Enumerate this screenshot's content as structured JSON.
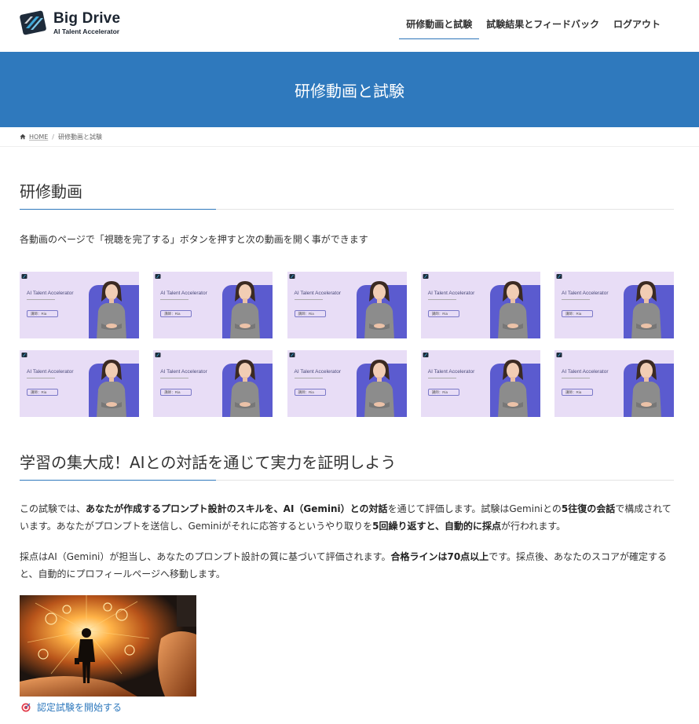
{
  "header": {
    "logo_title": "Big Drive",
    "logo_subtitle": "AI Talent Accelerator",
    "nav": [
      {
        "label": "研修動画と試験",
        "active": true
      },
      {
        "label": "試験結果とフィードバック",
        "active": false
      },
      {
        "label": "ログアウト",
        "active": false
      }
    ]
  },
  "page_title": "研修動画と試験",
  "breadcrumb": {
    "home": "HOME",
    "separator": "/",
    "current": "研修動画と試験"
  },
  "section_videos": {
    "title": "研修動画",
    "lead": "各動画のページで「視聴を完了する」ボタンを押すと次の動画を開く事ができます",
    "thumbnail_title": "AI Talent Accelerator",
    "thumbnail_tag": "講師：Ria",
    "thumbnail_count": 10
  },
  "section_exam": {
    "title": "学習の集大成！AIとの対話を通じて実力を証明しよう",
    "para1": {
      "t1": "この試験では、",
      "b1": "あなたが作成するプロンプト設計のスキルを、AI（Gemini）との対話",
      "t2": "を通じて評価します。試験はGeminiとの",
      "b2": "5往復の会話",
      "t3": "で構成されています。あなたがプロンプトを送信し、Geminiがそれに応答するというやり取りを",
      "b3": "5回繰り返すと、自動的に採点",
      "t4": "が行われます。"
    },
    "para2": {
      "t1": "採点はAI（Gemini）が担当し、あなたのプロンプト設計の質に基づいて評価されます。",
      "b1": "合格ラインは70点以上",
      "t2": "です。採点後、あなたのスコアが確定すると、自動的にプロフィールページへ移動します。"
    },
    "start_link": "認定試験を開始する"
  },
  "colors": {
    "brand_blue": "#2f79bd",
    "thumb_bg": "#e8ddf6",
    "thumb_panel": "#5b5bcf"
  }
}
